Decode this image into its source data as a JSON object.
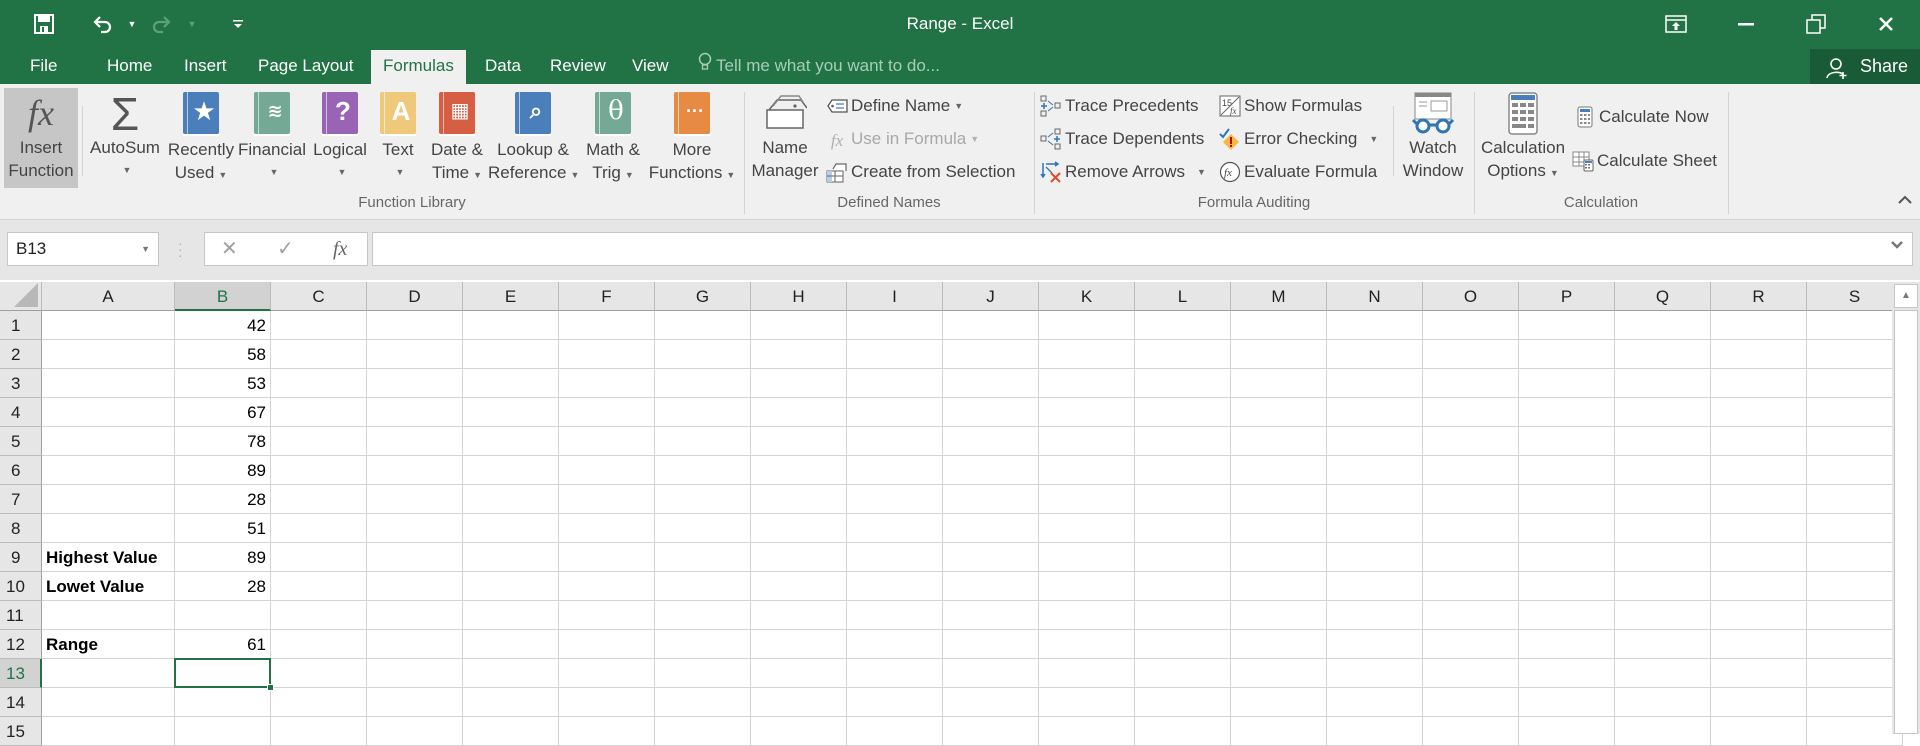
{
  "app": {
    "title": "Range - Excel",
    "colors": {
      "brand": "#217346",
      "brand_dark": "#195a37",
      "selection": "#217346"
    }
  },
  "qat": {
    "save_icon": "save-icon",
    "undo_icon": "undo-icon",
    "redo_icon": "redo-icon",
    "customize_icon": "customize-qat-icon"
  },
  "window_controls": {
    "ribbon_display": "ribbon-display-options-icon",
    "minimize": "minimize-icon",
    "restore": "restore-icon",
    "close": "close-icon"
  },
  "tabs": [
    {
      "label": "File"
    },
    {
      "label": "Home"
    },
    {
      "label": "Insert"
    },
    {
      "label": "Page Layout"
    },
    {
      "label": "Formulas",
      "active": true
    },
    {
      "label": "Data"
    },
    {
      "label": "Review"
    },
    {
      "label": "View"
    }
  ],
  "tell_me": {
    "placeholder": "Tell me what you want to do..."
  },
  "share": {
    "label": "Share"
  },
  "ribbon": {
    "function_library": {
      "label": "Function Library",
      "insert_function": {
        "line1": "Insert",
        "line2": "Function"
      },
      "autosum": {
        "line1": "AutoSum"
      },
      "recently_used": {
        "line1": "Recently",
        "line2": "Used"
      },
      "financial": {
        "line1": "Financial"
      },
      "logical": {
        "line1": "Logical"
      },
      "text": {
        "line1": "Text"
      },
      "date_time": {
        "line1": "Date &",
        "line2": "Time"
      },
      "lookup": {
        "line1": "Lookup &",
        "line2": "Reference"
      },
      "math": {
        "line1": "Math &",
        "line2": "Trig"
      },
      "more": {
        "line1": "More",
        "line2": "Functions"
      }
    },
    "defined_names": {
      "label": "Defined Names",
      "name_manager": {
        "line1": "Name",
        "line2": "Manager"
      },
      "define_name": "Define Name",
      "use_in_formula": "Use in Formula",
      "create_from_selection": "Create from Selection"
    },
    "formula_auditing": {
      "label": "Formula Auditing",
      "trace_precedents": "Trace Precedents",
      "trace_dependents": "Trace Dependents",
      "remove_arrows": "Remove Arrows",
      "show_formulas": "Show Formulas",
      "error_checking": "Error Checking",
      "evaluate_formula": "Evaluate Formula",
      "watch_window": {
        "line1": "Watch",
        "line2": "Window"
      }
    },
    "calculation": {
      "label": "Calculation",
      "calculation_options": {
        "line1": "Calculation",
        "line2": "Options"
      },
      "calculate_now": "Calculate Now",
      "calculate_sheet": "Calculate Sheet"
    }
  },
  "formula_bar": {
    "name_box": "B13",
    "cancel": "✕",
    "enter": "✓",
    "fx": "fx",
    "formula": ""
  },
  "sheet": {
    "columns": [
      "A",
      "B",
      "C",
      "D",
      "E",
      "F",
      "G",
      "H",
      "I",
      "J",
      "K",
      "L",
      "M",
      "N",
      "O",
      "P",
      "Q",
      "R",
      "S"
    ],
    "rows": [
      "1",
      "2",
      "3",
      "4",
      "5",
      "6",
      "7",
      "8",
      "9",
      "10",
      "11",
      "12",
      "13",
      "14",
      "15"
    ],
    "selected_cell": "B13",
    "cells": {
      "A9": "Highest Value",
      "A10": "Lowet Value",
      "A12": "Range",
      "B1": "42",
      "B2": "58",
      "B3": "53",
      "B4": "67",
      "B5": "78",
      "B6": "89",
      "B7": "28",
      "B8": "51",
      "B9": "89",
      "B10": "28",
      "B12": "61"
    }
  }
}
